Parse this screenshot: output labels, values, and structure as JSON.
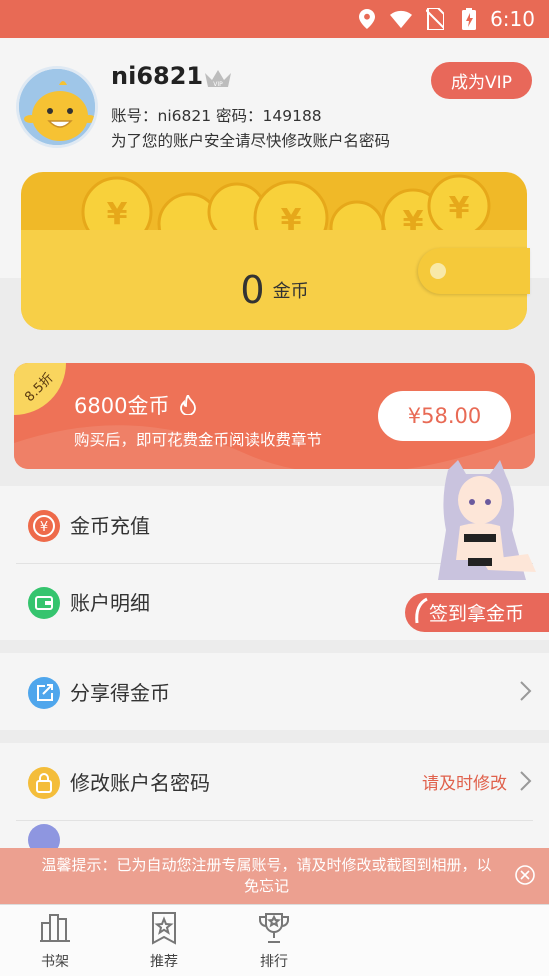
{
  "status_bar": {
    "time": "6:10"
  },
  "profile": {
    "username": "ni6821",
    "account_line": "账号：ni6821 密码：149188",
    "warning": "为了您的账户安全请尽快修改账户名密码",
    "vip_button": "成为VIP"
  },
  "wallet": {
    "coins": "0",
    "unit": "金币"
  },
  "promo": {
    "badge": "8.5折",
    "title": "6800金币",
    "subtitle": "购买后，即可花费金币阅读收费章节",
    "price": "¥58.00"
  },
  "menu": {
    "recharge": "金币充值",
    "details": "账户明细",
    "share": "分享得金币",
    "modify": "修改账户名密码",
    "modify_hint": "请及时修改"
  },
  "sign_button": "签到拿金币",
  "toast": {
    "text": "温馨提示：已为自动您注册专属账号，请及时修改或截图到相册，以免忘记"
  },
  "nav": {
    "shelf": "书架",
    "recommend": "推荐",
    "rank": "排行"
  },
  "colors": {
    "accent": "#e8685a",
    "wallet": "#f0b928"
  }
}
